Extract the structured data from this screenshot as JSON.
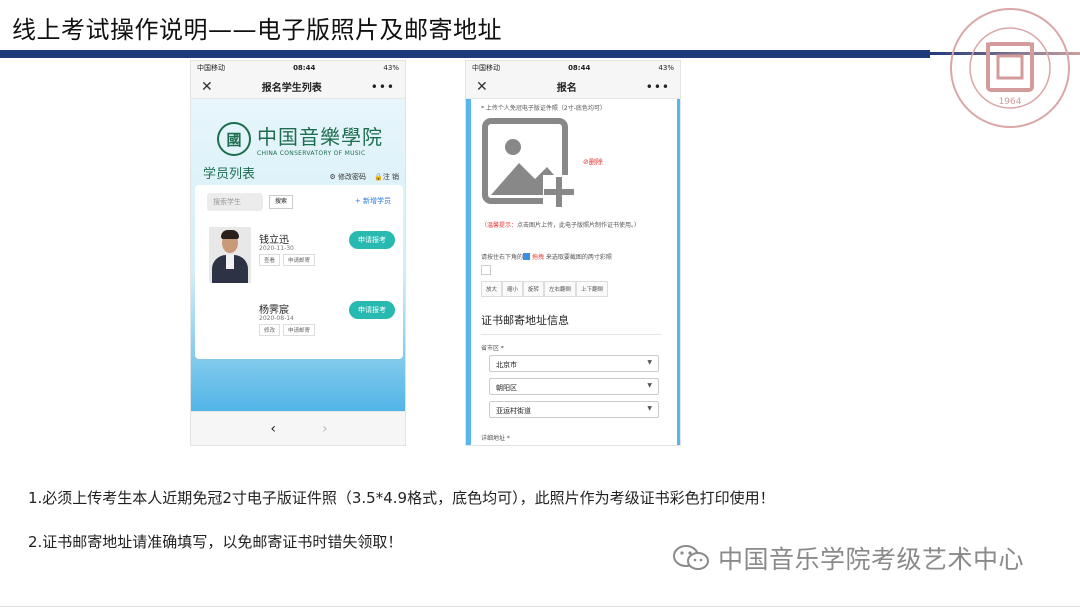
{
  "slide": {
    "title": "线上考试操作说明——电子版照片及邮寄地址",
    "seal_year": "1964",
    "seal_text": "CHINA CONSERVATORY OF MUSIC",
    "note1": "1.必须上传考生本人近期免冠2寸电子版证件照（3.5*4.9格式，底色均可），此照片作为考级证书彩色打印使用！",
    "note2": "2.证书邮寄地址请准确填写，以免邮寄证书时错失领取！",
    "watermark": "中国音乐学院考级艺术中心"
  },
  "phone1": {
    "status": {
      "carrier": "中国移动",
      "time": "08:44",
      "battery": "43%"
    },
    "nav_title": "报名学生列表",
    "logo_cn": "中国音樂學院",
    "logo_en": "CHINA CONSERVATORY OF MUSIC",
    "list_title": "学员列表",
    "change_password": "修改密码",
    "logout": "注 销",
    "search_placeholder": "搜索学生",
    "search_button": "搜索",
    "add_student": "新增学员",
    "students": [
      {
        "name": "钱立迅",
        "date": "2020-11-30",
        "link1": "查看",
        "link2": "申请邮寄",
        "action": "申请报考"
      },
      {
        "name": "杨霁宸",
        "date": "2020-08-14",
        "link1": "修改",
        "link2": "申请邮寄",
        "action": "申请报考"
      }
    ]
  },
  "phone2": {
    "status": {
      "carrier": "中国移动",
      "time": "08:44",
      "battery": "43%"
    },
    "nav_title": "报名",
    "upload_label": "* 上传个人免冠电子版证件照（2寸-底色均可）",
    "delete": "删除",
    "tip_red": "（温馨提示：",
    "tip_rest": "点击图片上传，此电子版照片制作证书使用。）",
    "crop_tip_pre": "请按住右下角的",
    "crop_tip_red": "拖拽",
    "crop_tip_post": "来选取要截图的两寸彩照",
    "tools": [
      "放大",
      "缩小",
      "旋转",
      "左右翻倒",
      "上下翻倒"
    ],
    "address_title": "证书邮寄地址信息",
    "region_label": "省市区 *",
    "province": "北京市",
    "district": "朝阳区",
    "street": "亚运村街道",
    "detail_label": "详细地址 *"
  }
}
